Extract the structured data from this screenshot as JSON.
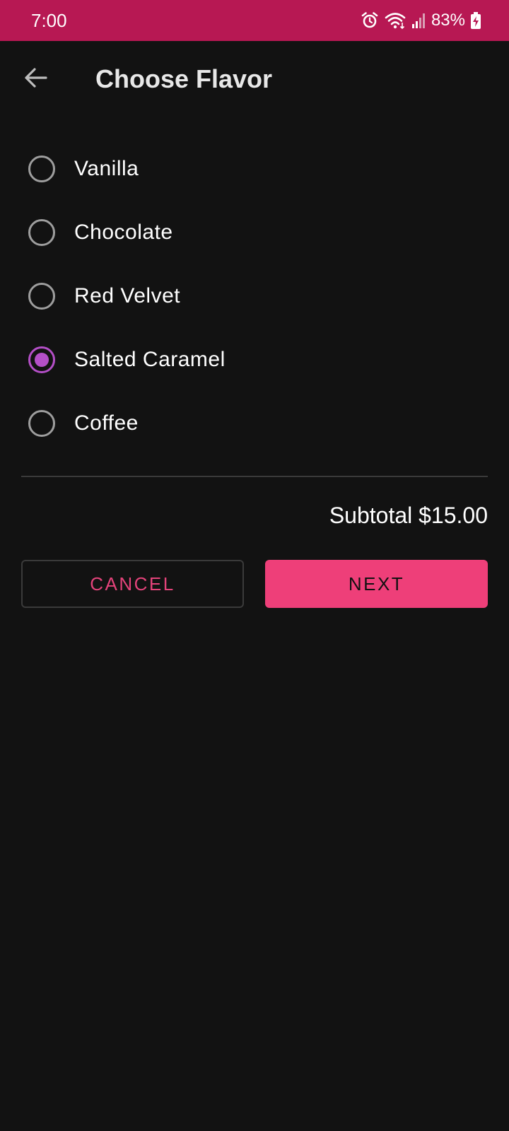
{
  "status_bar": {
    "time": "7:00",
    "battery": "83%",
    "icons": [
      "alarm-icon",
      "wifi-icon",
      "signal-icon",
      "battery-charging-icon"
    ]
  },
  "header": {
    "back_icon": "arrow-back-icon",
    "title": "Choose Flavor"
  },
  "flavors": {
    "items": [
      {
        "label": "Vanilla",
        "selected": false
      },
      {
        "label": "Chocolate",
        "selected": false
      },
      {
        "label": "Red Velvet",
        "selected": false
      },
      {
        "label": "Salted Caramel",
        "selected": true
      },
      {
        "label": "Coffee",
        "selected": false
      }
    ]
  },
  "summary": {
    "subtotal": "Subtotal $15.00"
  },
  "actions": {
    "cancel_label": "CANCEL",
    "next_label": "NEXT"
  },
  "colors": {
    "status_bar": "#b71853",
    "background": "#121212",
    "accent_pink": "#ee3f79",
    "radio_selected": "#b44fc7",
    "radio_unselected": "#9e9e9e"
  }
}
